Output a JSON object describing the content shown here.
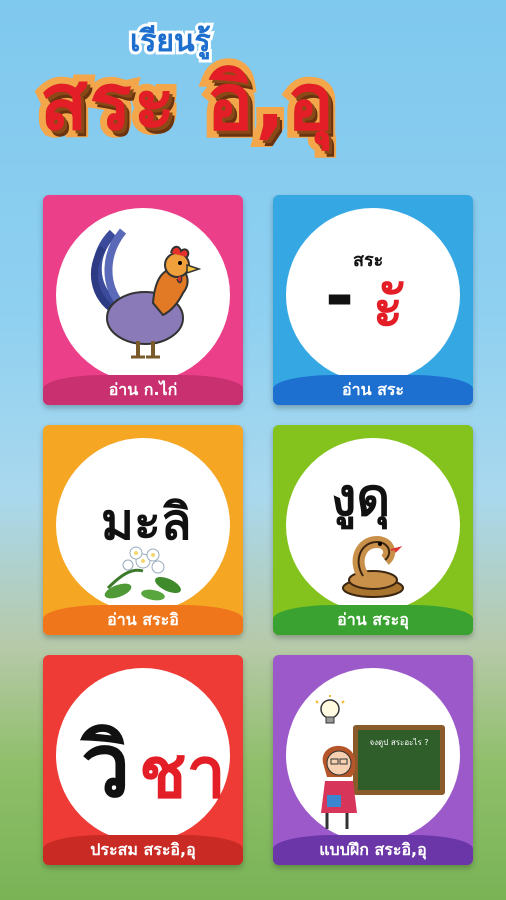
{
  "header": {
    "subtitle": "เรียนรู้",
    "title": "สระ อิ,อุ"
  },
  "cards": [
    {
      "label": "อ่าน ก.ไก่",
      "color": "#ec3f8a",
      "band": "#c8306f",
      "icon": "rooster-icon"
    },
    {
      "label": "อ่าน สระ",
      "color": "#35a8e4",
      "band": "#1d6fd0",
      "icon": "vowel-icon",
      "small": "สระ",
      "dash": "-",
      "vowel": "ะั"
    },
    {
      "label": "อ่าน สระอิ",
      "color": "#f5a623",
      "band": "#f0761b",
      "word": "มะลิ",
      "icon": "jasmine-flower-icon"
    },
    {
      "label": "อ่าน สระอุ",
      "color": "#84c21e",
      "band": "#3aa230",
      "word": "งูดุ",
      "icon": "snake-icon"
    },
    {
      "label": "ประสม สระอิ,อุ",
      "color": "#ee3b36",
      "band": "#c92a24",
      "word_a": "วิ",
      "word_b": "ชา"
    },
    {
      "label": "แบบฝึก สระอิ,อุ",
      "color": "#9b59c9",
      "band": "#6b36a8",
      "icon": "teacher-icon",
      "board_text": "จงดูป สระอะไร ?"
    }
  ]
}
